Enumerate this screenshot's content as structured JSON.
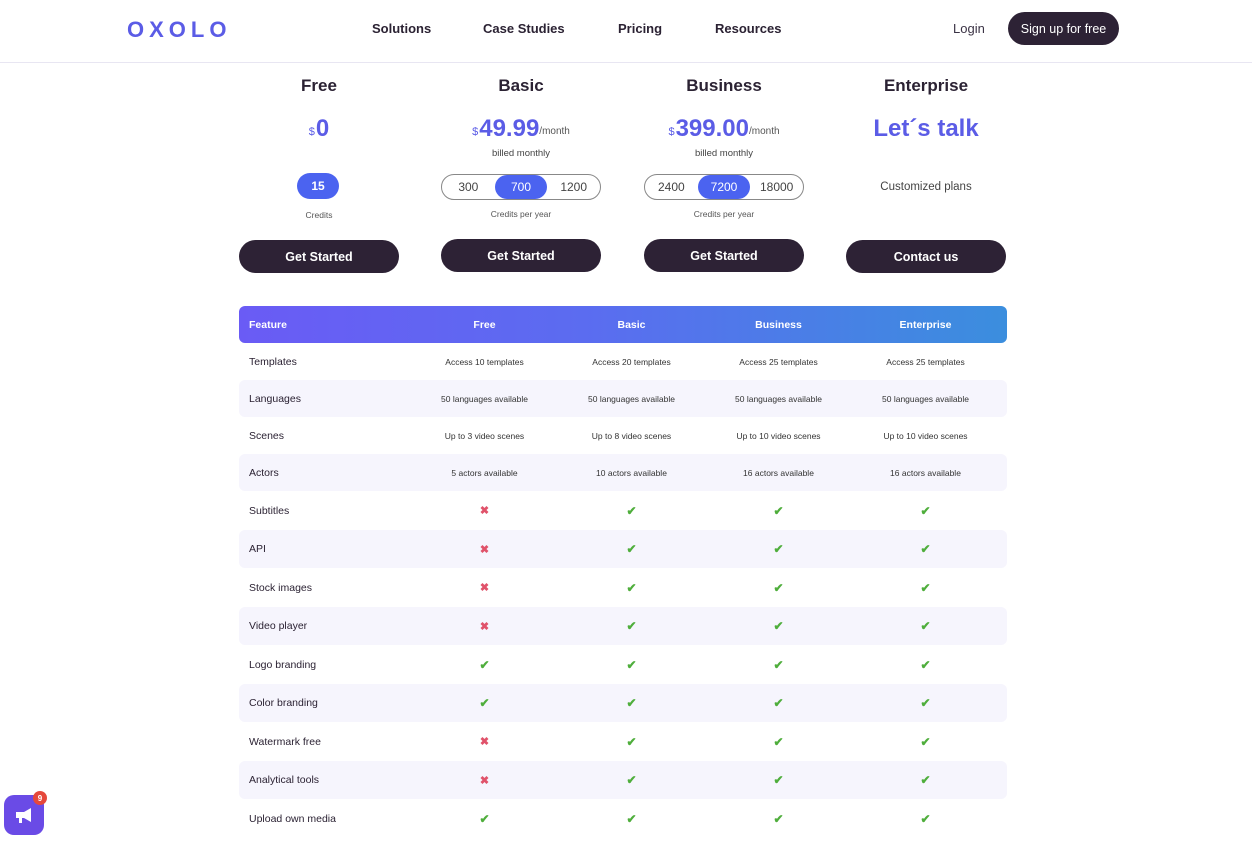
{
  "nav": {
    "logo": "OXOLO",
    "links": [
      "Solutions",
      "Case Studies",
      "Pricing",
      "Resources"
    ],
    "login": "Login",
    "signup": "Sign up for free"
  },
  "plans": [
    {
      "name": "Free",
      "currency": "$",
      "price": "0",
      "per": "",
      "billed": "",
      "credits_options": [
        "15"
      ],
      "credits_selected": "15",
      "credits_caption": "Credits",
      "cta": "Get Started"
    },
    {
      "name": "Basic",
      "currency": "$",
      "price": "49.99",
      "per": "/month",
      "billed": "billed monthly",
      "credits_options": [
        "300",
        "700",
        "1200"
      ],
      "credits_selected": "700",
      "credits_caption": "Credits per year",
      "cta": "Get Started"
    },
    {
      "name": "Business",
      "currency": "$",
      "price": "399.00",
      "per": "/month",
      "billed": "billed monthly",
      "credits_options": [
        "2400",
        "7200",
        "18000"
      ],
      "credits_selected": "7200",
      "credits_caption": "Credits per year",
      "cta": "Get Started"
    },
    {
      "name": "Enterprise",
      "headline": "Let´s talk",
      "subtitle": "Customized plans",
      "cta": "Contact us"
    }
  ],
  "table": {
    "headers": [
      "Feature",
      "Free",
      "Basic",
      "Business",
      "Enterprise"
    ],
    "rows": [
      {
        "feature": "Templates",
        "values": [
          "Access 10 templates",
          "Access 20 templates",
          "Access 25 templates",
          "Access 25 templates"
        ]
      },
      {
        "feature": "Languages",
        "values": [
          "50 languages available",
          "50 languages available",
          "50 languages available",
          "50 languages available"
        ]
      },
      {
        "feature": "Scenes",
        "values": [
          "Up to 3 video scenes",
          "Up to 8 video scenes",
          "Up to 10 video scenes",
          "Up to 10 video scenes"
        ]
      },
      {
        "feature": "Actors",
        "values": [
          "5 actors available",
          "10 actors available",
          "16 actors available",
          "16 actors available"
        ]
      },
      {
        "feature": "Subtitles",
        "values": [
          "cross",
          "check",
          "check",
          "check"
        ]
      },
      {
        "feature": "API",
        "values": [
          "cross",
          "check",
          "check",
          "check"
        ]
      },
      {
        "feature": "Stock images",
        "values": [
          "cross",
          "check",
          "check",
          "check"
        ]
      },
      {
        "feature": "Video player",
        "values": [
          "cross",
          "check",
          "check",
          "check"
        ]
      },
      {
        "feature": "Logo branding",
        "values": [
          "check",
          "check",
          "check",
          "check"
        ]
      },
      {
        "feature": "Color branding",
        "values": [
          "check",
          "check",
          "check",
          "check"
        ]
      },
      {
        "feature": "Watermark free",
        "values": [
          "cross",
          "check",
          "check",
          "check"
        ]
      },
      {
        "feature": "Analytical tools",
        "values": [
          "cross",
          "check",
          "check",
          "check"
        ]
      },
      {
        "feature": "Upload own media",
        "values": [
          "check",
          "check",
          "check",
          "check"
        ]
      }
    ]
  },
  "launcher": {
    "icon": "megaphone-icon",
    "badge_count": "9"
  },
  "colors": {
    "accent": "#5b5ce6",
    "dark": "#2d2235",
    "check": "#4fae3c",
    "cross": "#e0526a"
  }
}
